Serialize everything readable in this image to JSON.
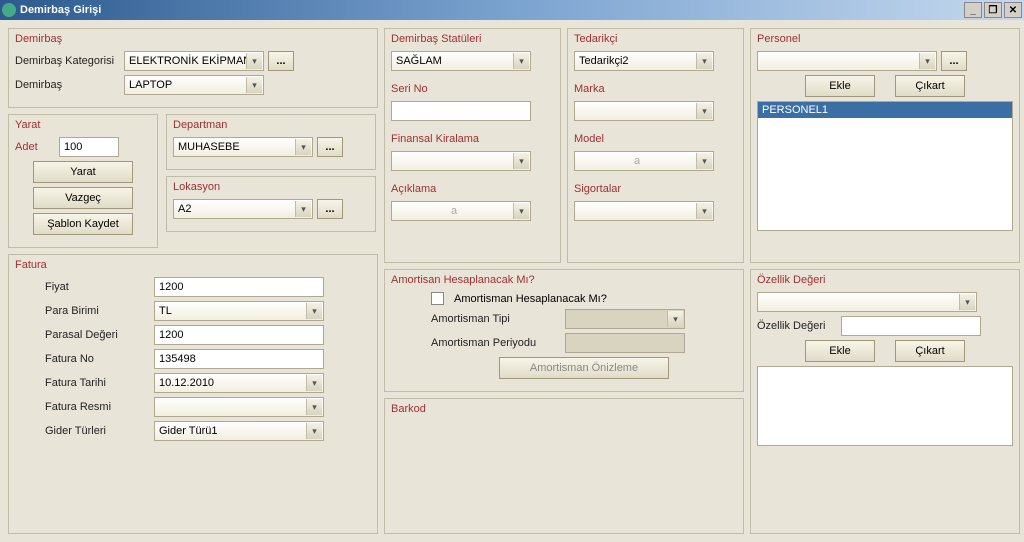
{
  "window": {
    "title": "Demirbaş Girişi"
  },
  "demirbas": {
    "title": "Demirbaş",
    "kategori_label": "Demirbaş Kategorisi",
    "kategori_value": "ELEKTRONİK EKİPMAN",
    "demirbas_label": "Demirbaş",
    "demirbas_value": "LAPTOP"
  },
  "yarat": {
    "title": "Yarat",
    "adet_label": "Adet",
    "adet_value": "100",
    "yarat_btn": "Yarat",
    "vazgec_btn": "Vazgeç",
    "sablon_btn": "Şablon Kaydet"
  },
  "departman": {
    "title": "Departman",
    "value": "MUHASEBE"
  },
  "lokasyon": {
    "title": "Lokasyon",
    "value": "A2"
  },
  "statu": {
    "title": "Demirbaş Statüleri",
    "value": "SAĞLAM",
    "serino_label": "Seri No",
    "serino_value": "",
    "finkir_label": "Finansal Kiralama",
    "finkir_value": "",
    "aciklama_label": "Açıklama",
    "aciklama_value": ""
  },
  "tedarikci": {
    "title": "Tedarikçi",
    "value": "Tedarikçi2",
    "marka_label": "Marka",
    "marka_value": "",
    "model_label": "Model",
    "model_value": "",
    "sigorta_label": "Sigortalar",
    "sigorta_value": ""
  },
  "personel": {
    "title": "Personel",
    "value": "",
    "ekle_btn": "Ekle",
    "cikart_btn": "Çıkart",
    "items": [
      "PERSONEL1"
    ]
  },
  "fatura": {
    "title": "Fatura",
    "fiyat_label": "Fiyat",
    "fiyat_value": "1200",
    "para_label": "Para Birimi",
    "para_value": "TL",
    "parasal_label": "Parasal Değeri",
    "parasal_value": "1200",
    "fatno_label": "Fatura No",
    "fatno_value": "135498",
    "fattarih_label": "Fatura Tarihi",
    "fattarih_value": "10.12.2010",
    "fatresmi_label": "Fatura Resmi",
    "fatresmi_value": "",
    "gider_label": "Gider Türleri",
    "gider_value": "Gider Türü1"
  },
  "amort": {
    "title": "Amortisan Hesaplanacak Mı?",
    "check_label": "Amortisman Hesaplanacak Mı?",
    "tipi_label": "Amortisman Tipi",
    "periyod_label": "Amortisman Periyodu",
    "onizleme_btn": "Amortisman Önizleme"
  },
  "barkod": {
    "title": "Barkod"
  },
  "ozellik": {
    "title": "Özellik Değeri",
    "label": "Özellik Değeri",
    "ekle_btn": "Ekle",
    "cikart_btn": "Çıkart"
  }
}
